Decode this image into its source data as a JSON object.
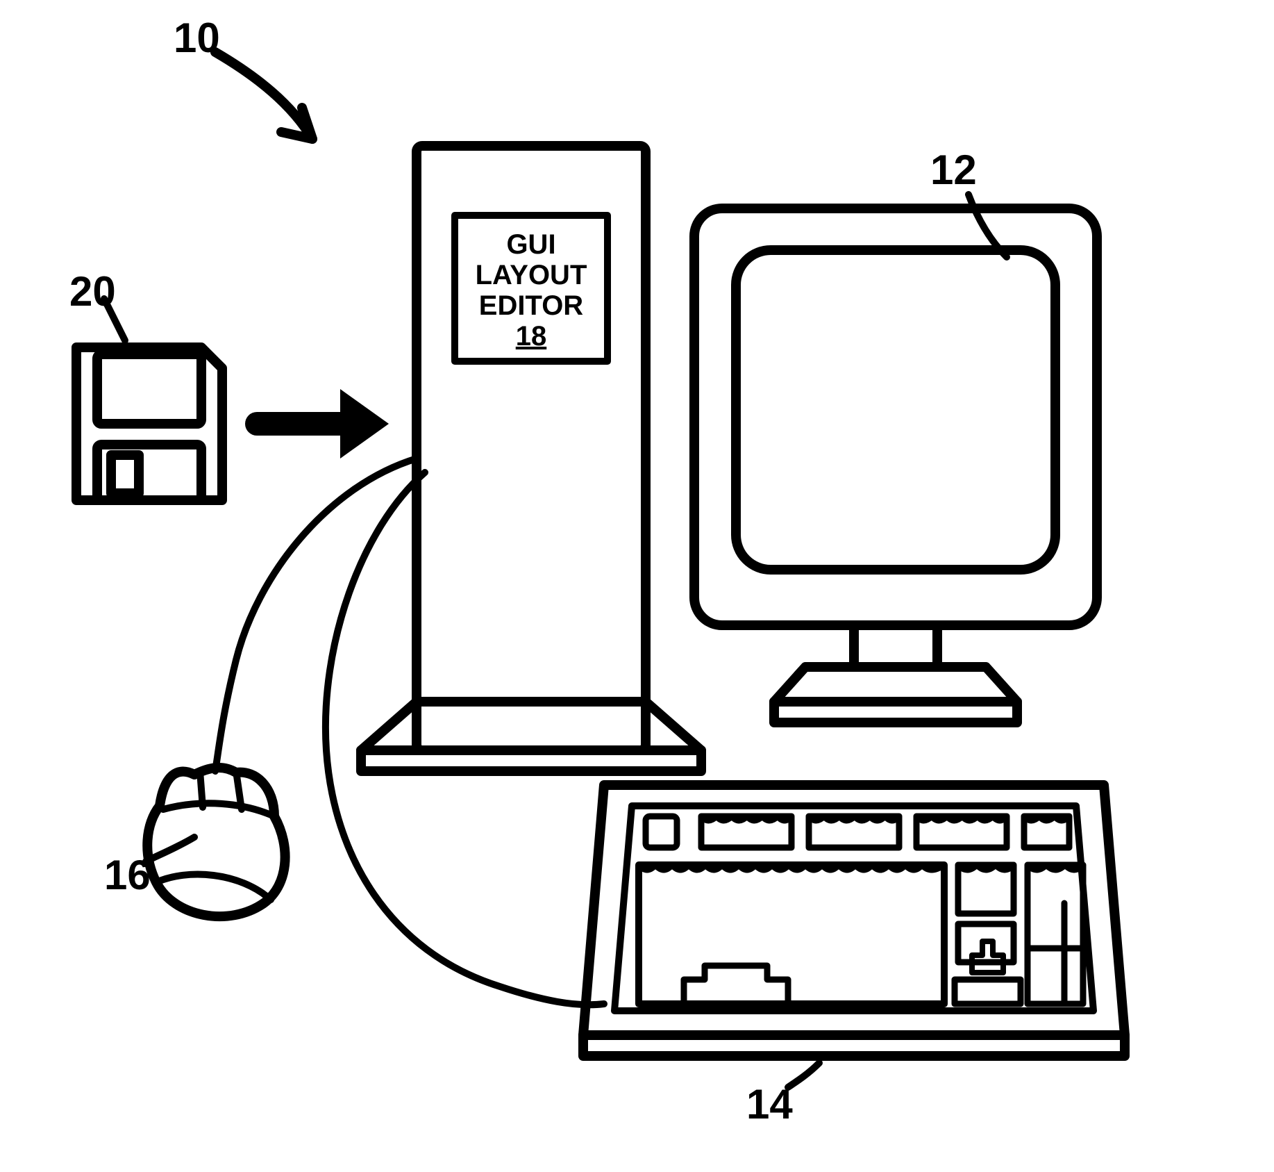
{
  "refs": {
    "system": "10",
    "monitor": "12",
    "keyboard": "14",
    "mouse": "16",
    "editor_ref": "18",
    "floppy": "20"
  },
  "tower": {
    "label_line1": "GUI LAYOUT",
    "label_line2": "EDITOR"
  }
}
